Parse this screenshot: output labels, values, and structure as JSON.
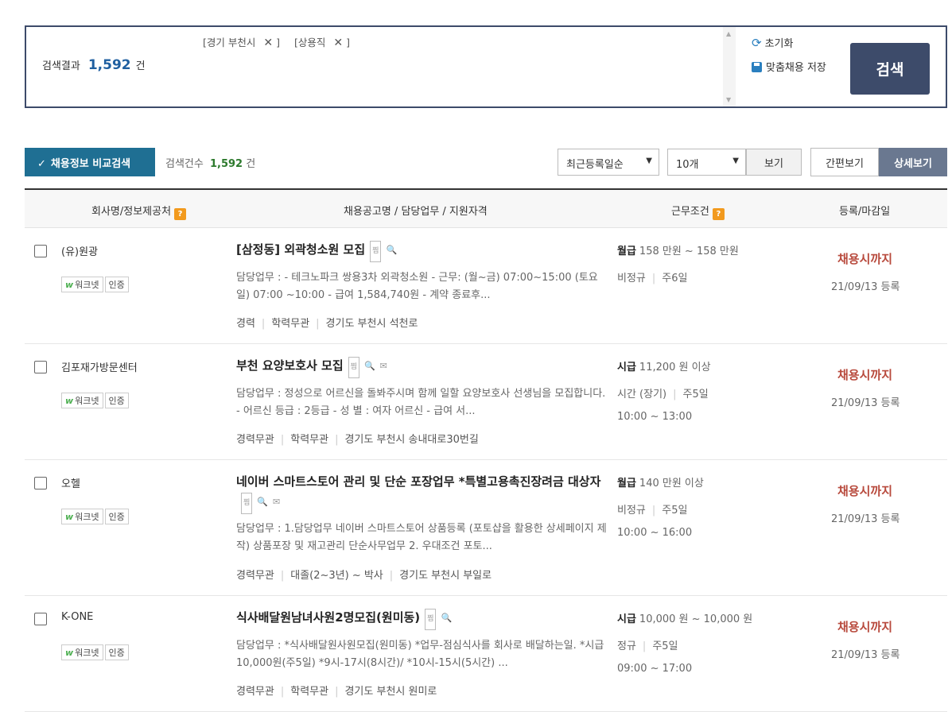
{
  "search": {
    "tags": [
      {
        "label": "[경기 부천시"
      },
      {
        "label": "[상용직"
      }
    ],
    "tag_close": "]",
    "result_label": "검색결과",
    "result_count": "1,592",
    "result_unit": "건",
    "reset_label": "초기화",
    "save_label": "맞춤채용 저장",
    "search_button": "검색"
  },
  "toolbar": {
    "compare_button": "채용정보 비교검색",
    "count_label": "검색건수",
    "count_value": "1,592",
    "count_unit": "건",
    "sort_selected": "최근등록일순",
    "perpage_selected": "10개",
    "view_button": "보기",
    "simple_view": "간편보기",
    "detail_view": "상세보기"
  },
  "table": {
    "headers": [
      "회사명/정보제공처",
      "채용공고명 / 담당업무 / 지원자격",
      "근무조건",
      "등록/마감일"
    ],
    "help_icon": "?"
  },
  "common": {
    "worknet": "워크넷",
    "certified": "인증",
    "status": "채용시까지",
    "scrap_icon_text": "찜"
  },
  "rows": [
    {
      "company": "(유)원광",
      "title": "[삼정동] 외곽청소원 모집",
      "desc": "담당업무 : - 테크노파크 쌍용3차 외곽청소원 - 근무: (월~금) 07:00~15:00 (토요일) 07:00 ~10:00 - 급여 1,584,740원 - 계약 종료후...",
      "meta": [
        "경력",
        "학력무관",
        "경기도 부천시 석천로"
      ],
      "pay_type": "월급",
      "pay": "158 만원 ~ 158 만원",
      "cond1": [
        "비정규",
        "주6일"
      ],
      "hours": "",
      "registered": "21/09/13 등록"
    },
    {
      "company": "김포재가방문센터",
      "title": "부천 요양보호사 모집",
      "desc": "담당업무 : 정성으로 어르신을 돌봐주시며 함께 일할 요양보호사 선생님을 모집합니다. - 어르신 등급 : 2등급 - 성 별 : 여자 어르신 - 급여 서...",
      "meta": [
        "경력무관",
        "학력무관",
        "경기도 부천시 송내대로30번길"
      ],
      "pay_type": "시급",
      "pay": "11,200 원 이상",
      "cond1": [
        "시간 (장기)",
        "주5일"
      ],
      "hours": "10:00 ~ 13:00",
      "registered": "21/09/13 등록"
    },
    {
      "company": "오헬",
      "title": "네이버 스마트스토어 관리 및 단순 포장업무 *특별고용촉진장려금 대상자",
      "desc": "담당업무 : 1.담당업무 네이버 스마트스토어 상품등록 (포토샵을 활용한 상세페이지 제작) 상품포장 및 재고관리 단순사무업무 2. 우대조건 포토...",
      "meta": [
        "경력무관",
        "대졸(2~3년) ~ 박사",
        "경기도 부천시 부일로"
      ],
      "pay_type": "월급",
      "pay": "140 만원 이상",
      "cond1": [
        "비정규",
        "주5일"
      ],
      "hours": "10:00 ~ 16:00",
      "registered": "21/09/13 등록"
    },
    {
      "company": "K-ONE",
      "title": "식사배달원남녀사원2명모집(원미동)",
      "desc": "담당업무 : *식사배달원사원모집(원미동) *업무-점심식사를 회사로 배달하는일. *시급 10,000원(주5일) *9시-17시(8시간)/ *10시-15시(5시간) ...",
      "meta": [
        "경력무관",
        "학력무관",
        "경기도 부천시 원미로"
      ],
      "pay_type": "시급",
      "pay": "10,000 원 ~ 10,000 원",
      "cond1": [
        "정규",
        "주5일"
      ],
      "hours": "09:00 ~ 17:00",
      "registered": "21/09/13 등록"
    }
  ]
}
